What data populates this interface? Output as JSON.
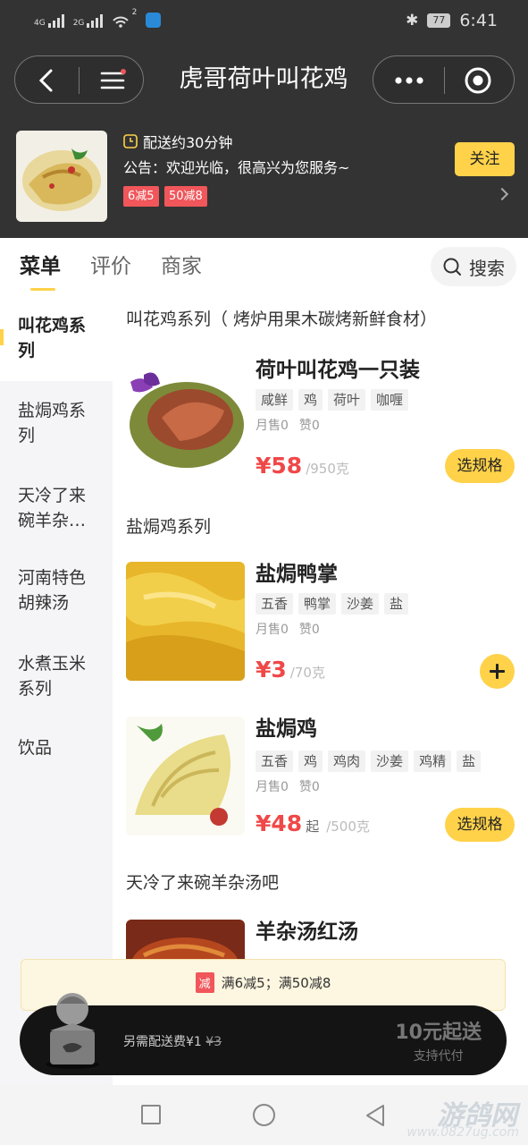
{
  "status_bar": {
    "signal1": "4G",
    "signal2": "2G",
    "wifi_badge": "2",
    "battery": "77",
    "time": "6:41"
  },
  "nav": {
    "title": "虎哥荷叶叫花鸡"
  },
  "shop": {
    "delivery": "配送约30分钟",
    "notice": "公告：欢迎光临，很高兴为您服务~",
    "promos": [
      "6减5",
      "50减8"
    ],
    "follow": "关注"
  },
  "tabs": [
    "菜单",
    "评价",
    "商家"
  ],
  "search_label": "搜索",
  "categories": [
    "叫花鸡系\n列",
    "盐焗鸡系\n列",
    "天冷了来\n碗羊杂…",
    "河南特色\n胡辣汤",
    "水煮玉米\n系列",
    "饮品"
  ],
  "sections": [
    {
      "title": "叫花鸡系列（ 烤炉用果木碳烤新鲜食材）"
    },
    {
      "title": "盐焗鸡系列"
    },
    {
      "title": "天冷了来碗羊杂汤吧"
    }
  ],
  "items": [
    {
      "name": "荷叶叫花鸡一只装",
      "tags": [
        "咸鲜",
        "鸡",
        "荷叶",
        "咖喱"
      ],
      "monthly": "月售0",
      "likes": "赞0",
      "price": "¥58",
      "qualifier": "",
      "unit": "/950克",
      "action": "选规格"
    },
    {
      "name": "盐焗鸭掌",
      "tags": [
        "五香",
        "鸭掌",
        "沙姜",
        "盐"
      ],
      "monthly": "月售0",
      "likes": "赞0",
      "price": "¥3",
      "qualifier": "",
      "unit": "/70克",
      "action": "+"
    },
    {
      "name": "盐焗鸡",
      "tags": [
        "五香",
        "鸡",
        "鸡肉",
        "沙姜",
        "鸡精",
        "盐"
      ],
      "monthly": "月售0",
      "likes": "赞0",
      "price": "¥48",
      "qualifier": "起",
      "unit": "/500克",
      "action": "选规格"
    },
    {
      "name": "羊杂汤红汤"
    }
  ],
  "cart": {
    "discount_badge": "减",
    "discount_text": "满6减5；满50减8",
    "extra_fee": "另需配送费¥1",
    "original_fee": "¥3",
    "min_order": "10元起送",
    "pay_for_other": "支持代付"
  },
  "watermark": {
    "main": "游鸽网",
    "url": "www.0827ug.com"
  },
  "colors": {
    "accent": "#ffd24a",
    "price": "#f04848",
    "promo": "#f0565a",
    "header": "#333333"
  }
}
